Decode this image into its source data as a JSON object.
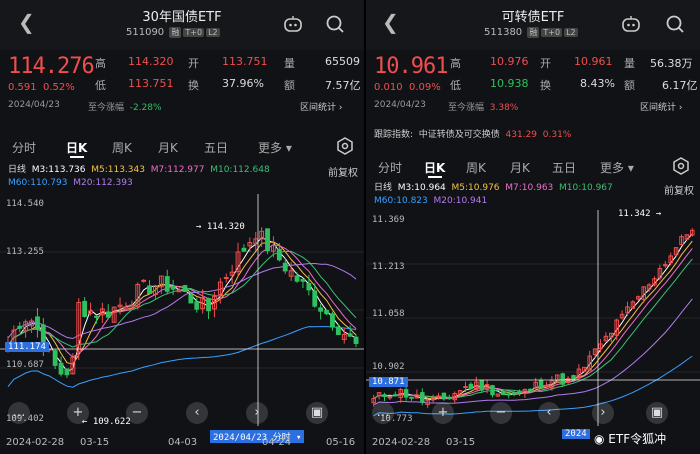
{
  "left": {
    "title": "30年国债ETF",
    "code": "511090",
    "tags": [
      "融",
      "T+0",
      "L2"
    ],
    "price": "114.276",
    "change": "0.591",
    "change_pct": "0.52%",
    "date": "2024/04/23",
    "stats": [
      {
        "label": "高",
        "value": "114.320",
        "color": "red"
      },
      {
        "label": "开",
        "value": "113.751",
        "color": "red"
      },
      {
        "label": "量",
        "value": "65509",
        "color": "white"
      },
      {
        "label": "低",
        "value": "113.751",
        "color": "red"
      },
      {
        "label": "换",
        "value": "37.96%",
        "color": "white"
      },
      {
        "label": "额",
        "value": "7.57亿",
        "color": "white"
      }
    ],
    "since_label": "至今涨幅",
    "since_value": "-2.28%",
    "range_stat": "区间统计",
    "tabs": [
      "分时",
      "日K",
      "周K",
      "月K",
      "五日",
      "更多"
    ],
    "active_tab": "日K",
    "settings_icon": "settings-hex-icon",
    "adj": "前复权",
    "ma_line1": [
      {
        "text": "日线",
        "color": "#dddddd"
      },
      {
        "text": "M3:113.736",
        "color": "#ffffff"
      },
      {
        "text": "M5:113.343",
        "color": "#f5c242"
      },
      {
        "text": "M7:112.977",
        "color": "#f06ec8"
      },
      {
        "text": "M10:112.648",
        "color": "#3bbf74"
      }
    ],
    "ma_line2": [
      {
        "text": "M60:110.793",
        "color": "#3aa0ff"
      },
      {
        "text": "M20:112.393",
        "color": "#b27bf0"
      }
    ],
    "y_labels": [
      "114.540",
      "113.255",
      "111.174",
      "110.687",
      "109.402"
    ],
    "current_price_box": "111.174",
    "max_marker": "114.320",
    "min_marker": "109.622",
    "crosshair_label": "2024/04/23 分时",
    "x_labels": [
      "2024-02-28",
      "03-15",
      "04-03",
      "04-24",
      "05-16"
    ],
    "controls": [
      "zoom-out-icon",
      "zoom-in-icon",
      "minus-icon",
      "prev-icon",
      "next-icon",
      "fullscreen-icon"
    ],
    "colors": {
      "up": "#f04e4e",
      "down": "#2ec15f"
    }
  },
  "right": {
    "title": "可转债ETF",
    "code": "511380",
    "tags": [
      "融",
      "T+0",
      "L2"
    ],
    "price": "10.961",
    "change": "0.010",
    "change_pct": "0.09%",
    "date": "2024/04/23",
    "stats": [
      {
        "label": "高",
        "value": "10.976",
        "color": "red"
      },
      {
        "label": "开",
        "value": "10.961",
        "color": "red"
      },
      {
        "label": "量",
        "value": "56.38万",
        "color": "white"
      },
      {
        "label": "低",
        "value": "10.938",
        "color": "green"
      },
      {
        "label": "换",
        "value": "8.43%",
        "color": "white"
      },
      {
        "label": "额",
        "value": "6.17亿",
        "color": "white"
      }
    ],
    "since_label": "至今涨幅",
    "since_value": "3.38%",
    "range_stat": "区间统计",
    "track_label": "跟踪指数:",
    "track_name": "中证转债及可交换债",
    "track_value": "431.29",
    "track_pct": "0.31%",
    "tabs": [
      "分时",
      "日K",
      "周K",
      "月K",
      "五日",
      "更多"
    ],
    "active_tab": "日K",
    "settings_icon": "settings-hex-icon",
    "adj": "前复权",
    "ma_line1": [
      {
        "text": "日线",
        "color": "#dddddd"
      },
      {
        "text": "M3:10.964",
        "color": "#ffffff"
      },
      {
        "text": "M5:10.976",
        "color": "#f5c242"
      },
      {
        "text": "M7:10.963",
        "color": "#f06ec8"
      },
      {
        "text": "M10:10.967",
        "color": "#3bbf74"
      }
    ],
    "ma_line2": [
      {
        "text": "M60:10.823",
        "color": "#3aa0ff"
      },
      {
        "text": "M20:10.941",
        "color": "#b27bf0"
      }
    ],
    "y_labels": [
      "11.369",
      "11.213",
      "11.058",
      "10.902",
      "10.871",
      "10.773"
    ],
    "current_price_box": "10.871",
    "max_marker": "11.342",
    "x_labels": [
      "2024-02-28",
      "03-15"
    ],
    "crosshair_label": "2024",
    "controls": [
      "zoom-out-icon",
      "zoom-in-icon",
      "minus-icon",
      "prev-icon",
      "next-icon",
      "fullscreen-icon"
    ],
    "watermark": "ETF令狐冲",
    "colors": {
      "up": "#f04e4e",
      "down": "#2ec15f"
    }
  }
}
